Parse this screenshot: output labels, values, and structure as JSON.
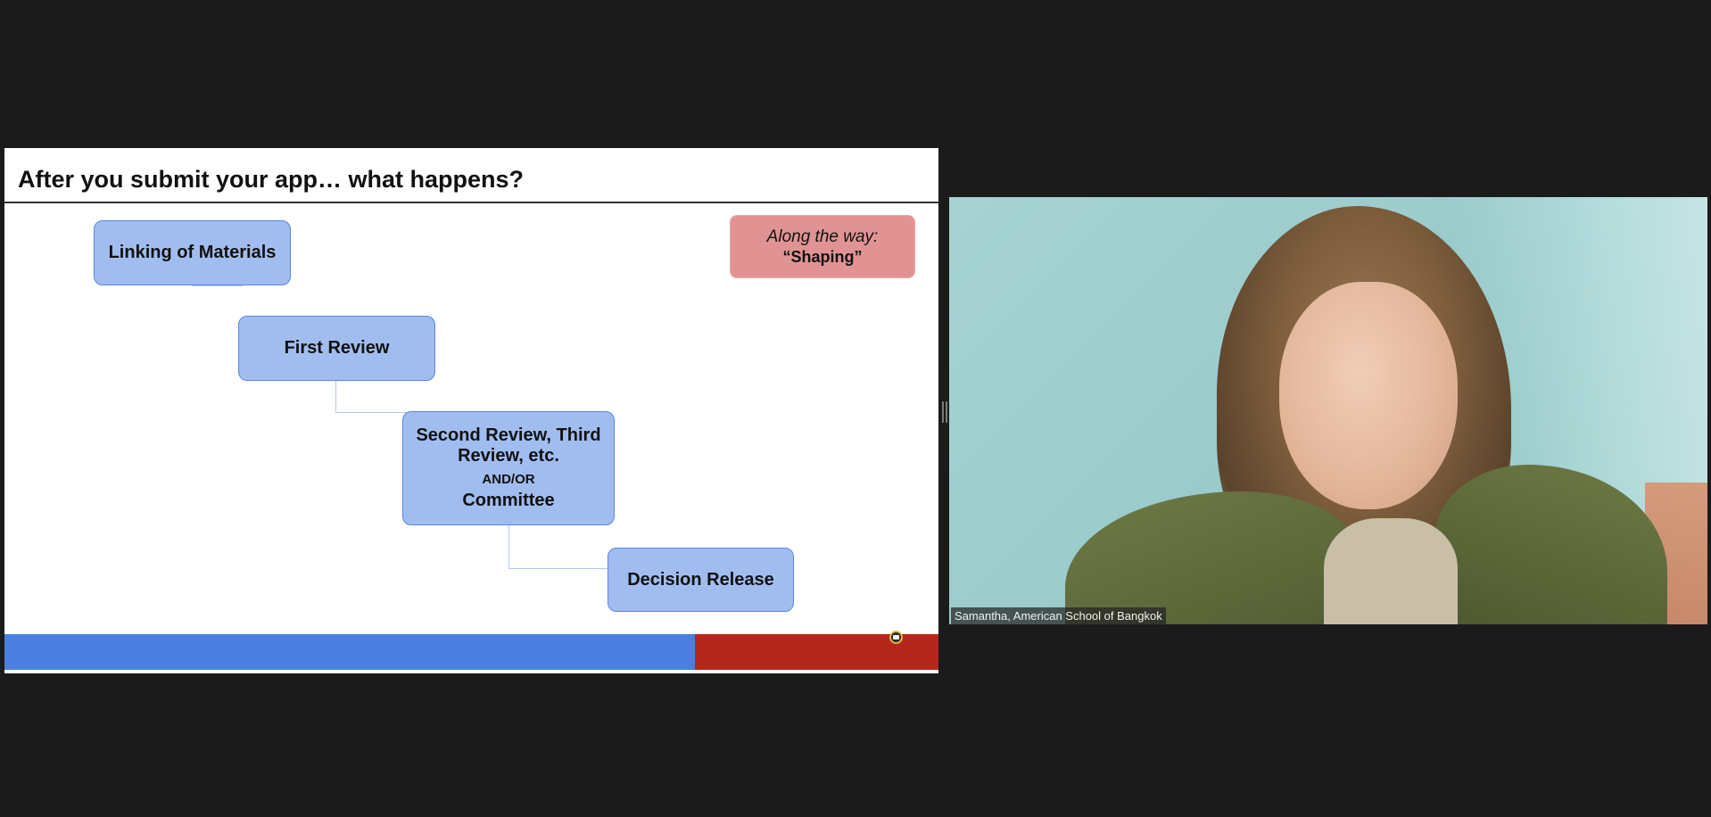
{
  "slide": {
    "title": "After you submit your app… what happens?",
    "flow": [
      {
        "label": "Linking of Materials"
      },
      {
        "label": "First Review"
      },
      {
        "label": "Second Review, Third Review, etc.",
        "connector_text": "AND/OR",
        "label2": "Committee"
      },
      {
        "label": "Decision Release"
      }
    ],
    "note": {
      "line1": "Along the way:",
      "line2": "“Shaping”"
    },
    "colors": {
      "node_fill": "#a1bdf0",
      "node_border": "#5b86dc",
      "note_fill": "#e19394",
      "bar_blue": "#4a7fe0",
      "bar_red": "#b5271c"
    }
  },
  "share_indicator": {
    "icon": "screen-share-icon"
  },
  "participant": {
    "name": "Samantha, American School of Bangkok"
  }
}
